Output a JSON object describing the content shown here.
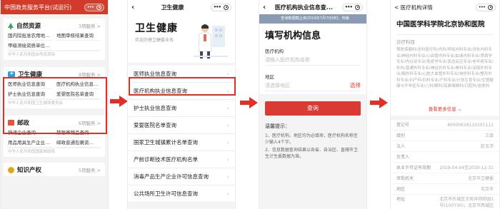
{
  "panel1": {
    "title": "中国政务服务平台(试运行)",
    "sections": [
      {
        "name": "自然资源",
        "count": "3项服务 >",
        "items": [
          "国内院批准农用地…",
          "地图审核结果查询",
          "甲级测绘资质单位…"
        ],
        "footer": "中华人民共和国自然资源部"
      },
      {
        "name": "卫生健康",
        "count": "9项服务 >",
        "items": [
          "医师执业信息查询",
          "医疗机构执业信息…",
          "护士执业信息查询",
          "爱婴医院名单查询"
        ],
        "footer": "中华人民共和国卫生健康委员会"
      },
      {
        "name": "邮政",
        "count": "6项服务 >",
        "items": [
          "快递企业查询",
          "禁限寄物品查询",
          "用品用具生产企业…",
          "邮政普通包裹资…"
        ],
        "footer": "中华人民共和国国家邮政局"
      },
      {
        "name": "知识产权",
        "count": "5项服务 >",
        "items": [],
        "footer": ""
      }
    ]
  },
  "panel2": {
    "title": "卫生健康",
    "hero_title": "卫生健康",
    "hero_sub": "欢迎办理卫健委业务",
    "items": [
      "医师执业信息查询",
      "医疗机构执业信息查询",
      "护士执业信息查询",
      "爱婴医院名单查询",
      "国家卫生城镇累计名单查询",
      "产前诊断技术医疗机构名单",
      "消毒产品生产企业许可信息查询",
      "公共场所卫生许可信息查询"
    ]
  },
  "panel3": {
    "title": "医疗机构执业信息查...",
    "notice": "查询数据截止到2019年7月7日0时，传播",
    "form_title": "填写机构信息",
    "label_org": "医疗机构",
    "placeholder_org": "请输入医疗机构名称",
    "label_area": "地区",
    "placeholder_area": "请选择地区",
    "pick": "选择",
    "button": "查询",
    "tips_title": "温馨提示：",
    "tips": [
      "1、医疗机构、地区均为必填项，医疗机构名称至少输入4个字。",
      "2、信息数据查询结果以各省、自治区、直辖市卫生计生委数据为准。"
    ]
  },
  "panel4": {
    "title": "< 医疗机构详情",
    "name": "中国医学科学院北京协和医院",
    "sub_label": "诊疗科目",
    "subjects": "预防保健科/全科医疗科/内科/呼吸内科专业/消化内科专业/神经内科专业/心血管内科专业/血液内科专业/肾病学专业/内分泌专业/免疫学专业/变态反应专业/老年病专业/外科/普通外科专业/神经外科专业/骨科专业/泌尿外科专业/胸外科专业/心脏大血管外科专业/烧伤科专业/整形外科专业/妇产科/妇科专业/产科专业/计划生育专业/生殖健康与不孕症专业/儿科/眼科/耳鼻咽喉科/口腔科/皮肤科",
    "more": "查看更多信息 ⌄",
    "rows": [
      {
        "k": "登记号",
        "v": "40000616110101111"
      },
      {
        "k": "级别",
        "v": "三级"
      },
      {
        "k": "法人",
        "v": "赵玉沛"
      },
      {
        "k": "负责人",
        "v": ""
      },
      {
        "k": "执业许可证有效期",
        "v": "2019-04-04至2030-12-31"
      },
      {
        "k": "审批机关",
        "v": "北京市卫健委"
      },
      {
        "k": "地区",
        "v": "北京市"
      },
      {
        "k": "地址",
        "v": "北京市东城区王府井帅府园1号(100730)；北京市西城区大木仓胡同41号"
      }
    ]
  }
}
